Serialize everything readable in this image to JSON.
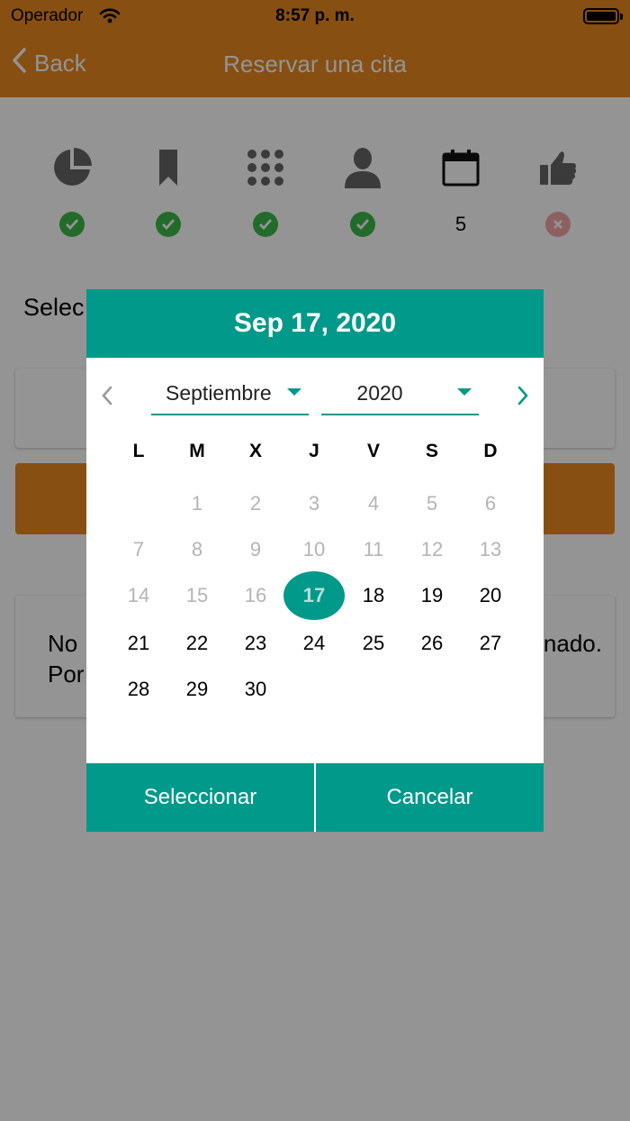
{
  "status_bar": {
    "carrier": "Operador",
    "time": "8:57 p. m."
  },
  "nav": {
    "back_label": "Back",
    "title": "Reservar una cita"
  },
  "steps": [
    {
      "icon": "pie-chart-icon",
      "status": "check"
    },
    {
      "icon": "bookmark-icon",
      "status": "check"
    },
    {
      "icon": "grid-icon",
      "status": "check"
    },
    {
      "icon": "user-icon",
      "status": "check"
    },
    {
      "icon": "calendar-icon",
      "status": "5"
    },
    {
      "icon": "thumbs-up-icon",
      "status": "x"
    }
  ],
  "content": {
    "select_label_visible": "Selec",
    "message_line1_left": "No",
    "message_line1_right": "nado.",
    "message_line2_left": "Por"
  },
  "dialog": {
    "header": "Sep 17, 2020",
    "month_value": "Septiembre",
    "year_value": "2020",
    "weekdays": [
      "L",
      "M",
      "X",
      "J",
      "V",
      "S",
      "D"
    ],
    "weeks": [
      [
        "",
        "1",
        "2",
        "3",
        "4",
        "5",
        "6"
      ],
      [
        "7",
        "8",
        "9",
        "10",
        "11",
        "12",
        "13"
      ],
      [
        "14",
        "15",
        "16",
        "17",
        "18",
        "19",
        "20"
      ],
      [
        "21",
        "22",
        "23",
        "24",
        "25",
        "26",
        "27"
      ],
      [
        "28",
        "29",
        "30",
        "",
        "",
        "",
        ""
      ]
    ],
    "selected_day": "17",
    "select_button": "Seleccionar",
    "cancel_button": "Cancelar"
  },
  "colors": {
    "brand": "#e8891f",
    "accent": "#00998a",
    "success": "#3cb84a",
    "error": "#f2a6a8"
  }
}
